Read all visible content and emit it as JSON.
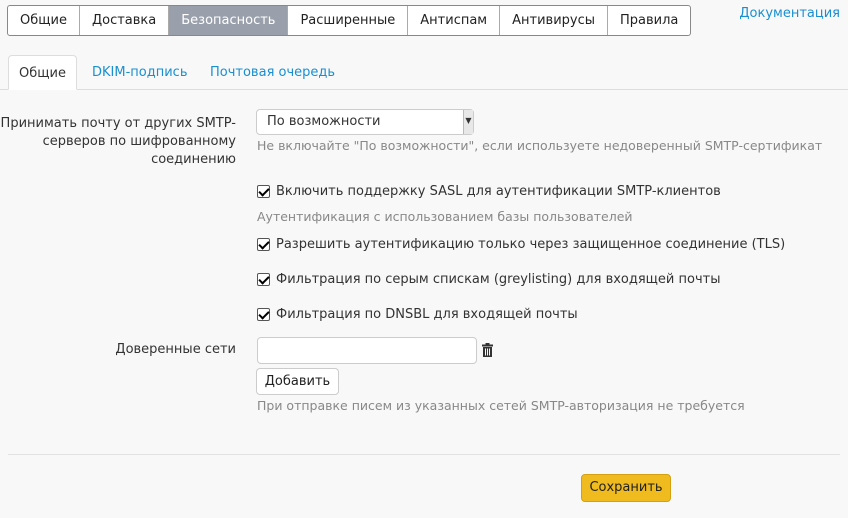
{
  "top_tabs": [
    "Общие",
    "Доставка",
    "Безопасность",
    "Расширенные",
    "Антиспам",
    "Антивирусы",
    "Правила"
  ],
  "active_top_tab": "Безопасность",
  "documentation_link": "Документация",
  "sub_tabs": [
    "Общие",
    "DKIM-подпись",
    "Почтовая очередь"
  ],
  "active_sub_tab": "Общие",
  "form": {
    "tls_label": "Принимать почту от других SMTP-\nсерверов по шифрованному\nсоединению",
    "tls_select_value": "По возможности",
    "tls_hint": "Не включайте \"По возможности\", если используете недоверенный SMTP-сертификат",
    "sasl_label": "Включить поддержку SASL для аутентификации SMTP-клиентов",
    "sasl_checked": true,
    "sasl_hint": "Аутентификация с использованием базы пользователей",
    "tls_only_label": "Разрешить аутентификацию только через защищенное соединение (TLS)",
    "tls_only_checked": true,
    "greylisting_label": "Фильтрация по серым спискам (greylisting) для входящей почты",
    "greylisting_checked": true,
    "dnsbl_label": "Фильтрация по DNSBL для входящей почты",
    "dnsbl_checked": true,
    "trusted_label": "Доверенные сети",
    "trusted_value": "",
    "add_button": "Добавить",
    "trusted_hint": "При отправке писем из указанных сетей SMTP-авторизация не требуется"
  },
  "save_button": "Сохранить",
  "colors": {
    "accent": "#1a8fd0",
    "active_tab": "#9aa0ab",
    "save": "#f0bb1f"
  }
}
